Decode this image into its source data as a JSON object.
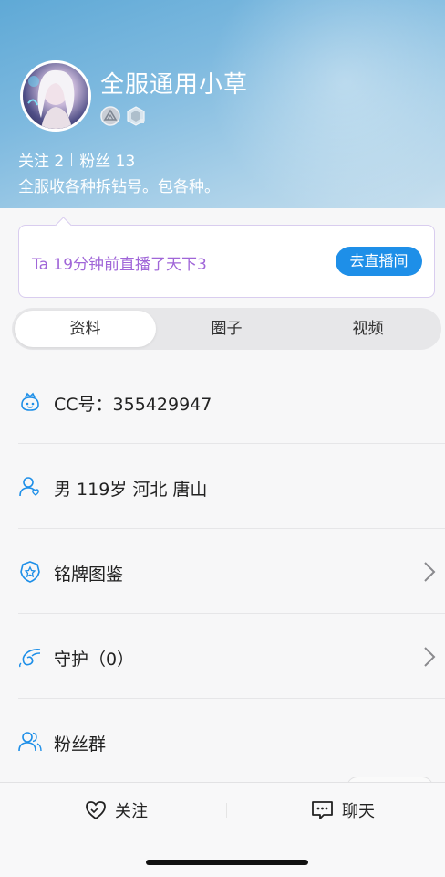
{
  "profile": {
    "username": "全服通用小草",
    "follow_label": "关注 2",
    "fans_label": "粉丝 13",
    "bio": "全服收各种拆钻号。包各种。",
    "badges": [
      "rank-badge-icon",
      "level-badge-icon"
    ]
  },
  "live": {
    "text": "Ta 19分钟前直播了天下3",
    "button": "去直播间",
    "accent": "#a066d8",
    "button_color": "#1e8fe8"
  },
  "tabs": [
    {
      "label": "资料",
      "active": true
    },
    {
      "label": "圈子",
      "active": false
    },
    {
      "label": "视频",
      "active": false
    }
  ],
  "info": [
    {
      "icon": "cc-mascot-icon",
      "label": "CC号：355429947",
      "chevron": false
    },
    {
      "icon": "user-gender-icon",
      "label": "男   119岁   河北 唐山",
      "chevron": false
    },
    {
      "icon": "medal-badge-icon",
      "label": "铭牌图鉴",
      "chevron": true
    },
    {
      "icon": "wing-guard-icon",
      "label": "守护（0）",
      "chevron": true
    },
    {
      "icon": "fans-group-icon",
      "label": "粉丝群",
      "chevron": false
    }
  ],
  "bottom_bar": {
    "follow": "关注",
    "chat": "聊天"
  },
  "colors": {
    "icon_blue": "#1e8fe8",
    "header_start": "#5fa9d6"
  }
}
